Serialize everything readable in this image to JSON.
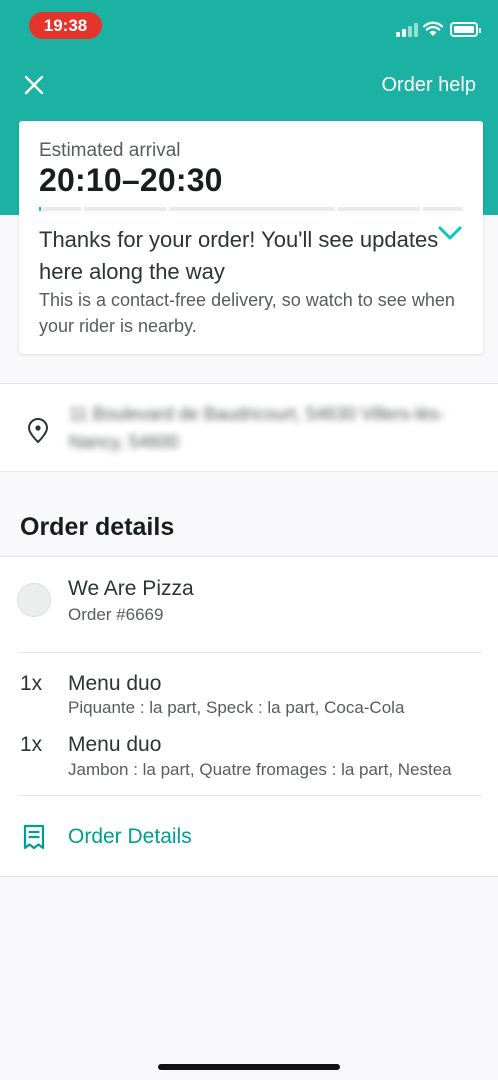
{
  "status_bar": {
    "time": "19:38"
  },
  "header": {
    "close_icon": "close-icon",
    "order_help": "Order help"
  },
  "arrival": {
    "label": "Estimated arrival",
    "time": "20:10–20:30",
    "progress_step": 1,
    "progress_total": 5,
    "message": "Thanks for your order! You'll see updates here along the way",
    "note": "This is a contact-free delivery, so watch to see when your rider is nearby."
  },
  "address": {
    "icon": "location-pin-icon",
    "text": "11 Boulevard de Baudricourt, 54630 Villers-lès-Nancy, 54600"
  },
  "order_details": {
    "title": "Order details",
    "restaurant": {
      "name": "We Are Pizza",
      "order_number": "Order #6669"
    },
    "items": [
      {
        "qty": "1x",
        "name": "Menu duo",
        "options": "Piquante : la part, Speck : la part, Coca-Cola"
      },
      {
        "qty": "1x",
        "name": "Menu duo",
        "options": "Jambon : la part, Quatre fromages : la part, Nestea"
      }
    ],
    "link_label": "Order Details",
    "link_icon": "receipt-icon"
  },
  "colors": {
    "brand": "#1bb2a3",
    "accent": "#00ccbc",
    "link": "#009e92",
    "time_pill": "#e4342c"
  }
}
